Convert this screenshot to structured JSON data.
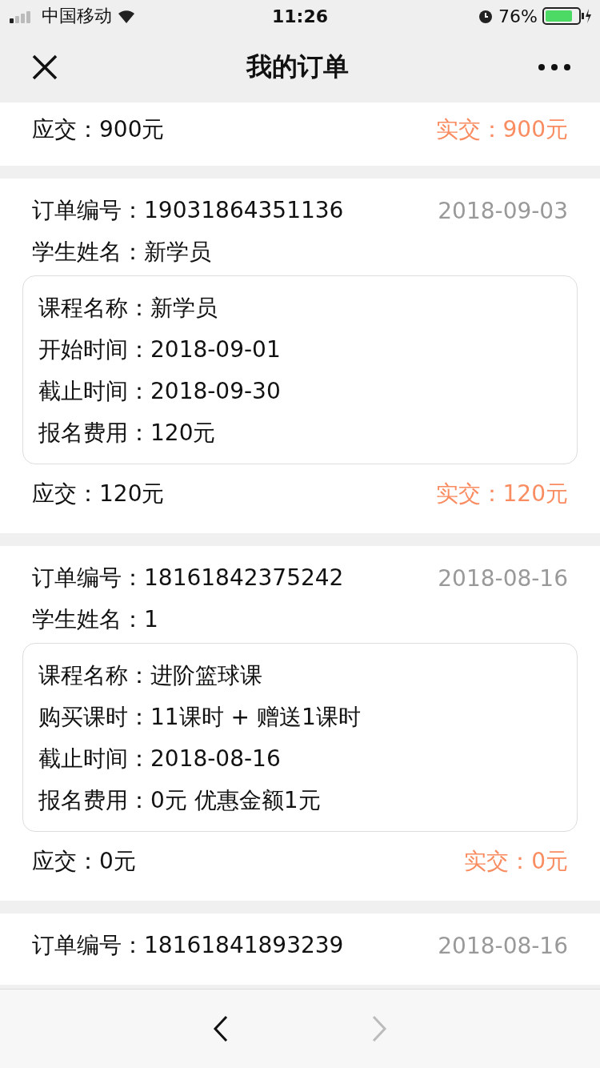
{
  "status_bar": {
    "carrier": "中国移动",
    "time": "11:26",
    "battery": "76%"
  },
  "nav": {
    "title": "我的订单"
  },
  "orders": [
    {
      "due": "应交：900元",
      "paid": "实交：900元"
    },
    {
      "number": "订单编号：19031864351136",
      "date": "2018-09-03",
      "student": "学生姓名：新学员",
      "details": [
        "课程名称：新学员",
        "开始时间：2018-09-01",
        "截止时间：2018-09-30",
        "报名费用：120元"
      ],
      "due": "应交：120元",
      "paid": "实交：120元"
    },
    {
      "number": "订单编号：18161842375242",
      "date": "2018-08-16",
      "student": "学生姓名：1",
      "details": [
        "课程名称：进阶篮球课",
        "购买课时：11课时 + 赠送1课时",
        "截止时间：2018-08-16",
        "报名费用：0元 优惠金额1元"
      ],
      "due": "应交：0元",
      "paid": "实交：0元"
    },
    {
      "number": "订单编号：18161841893239",
      "date": "2018-08-16"
    }
  ],
  "toolbar": {
    "back": {
      "disabled": false
    },
    "forward": {
      "disabled": true
    }
  }
}
